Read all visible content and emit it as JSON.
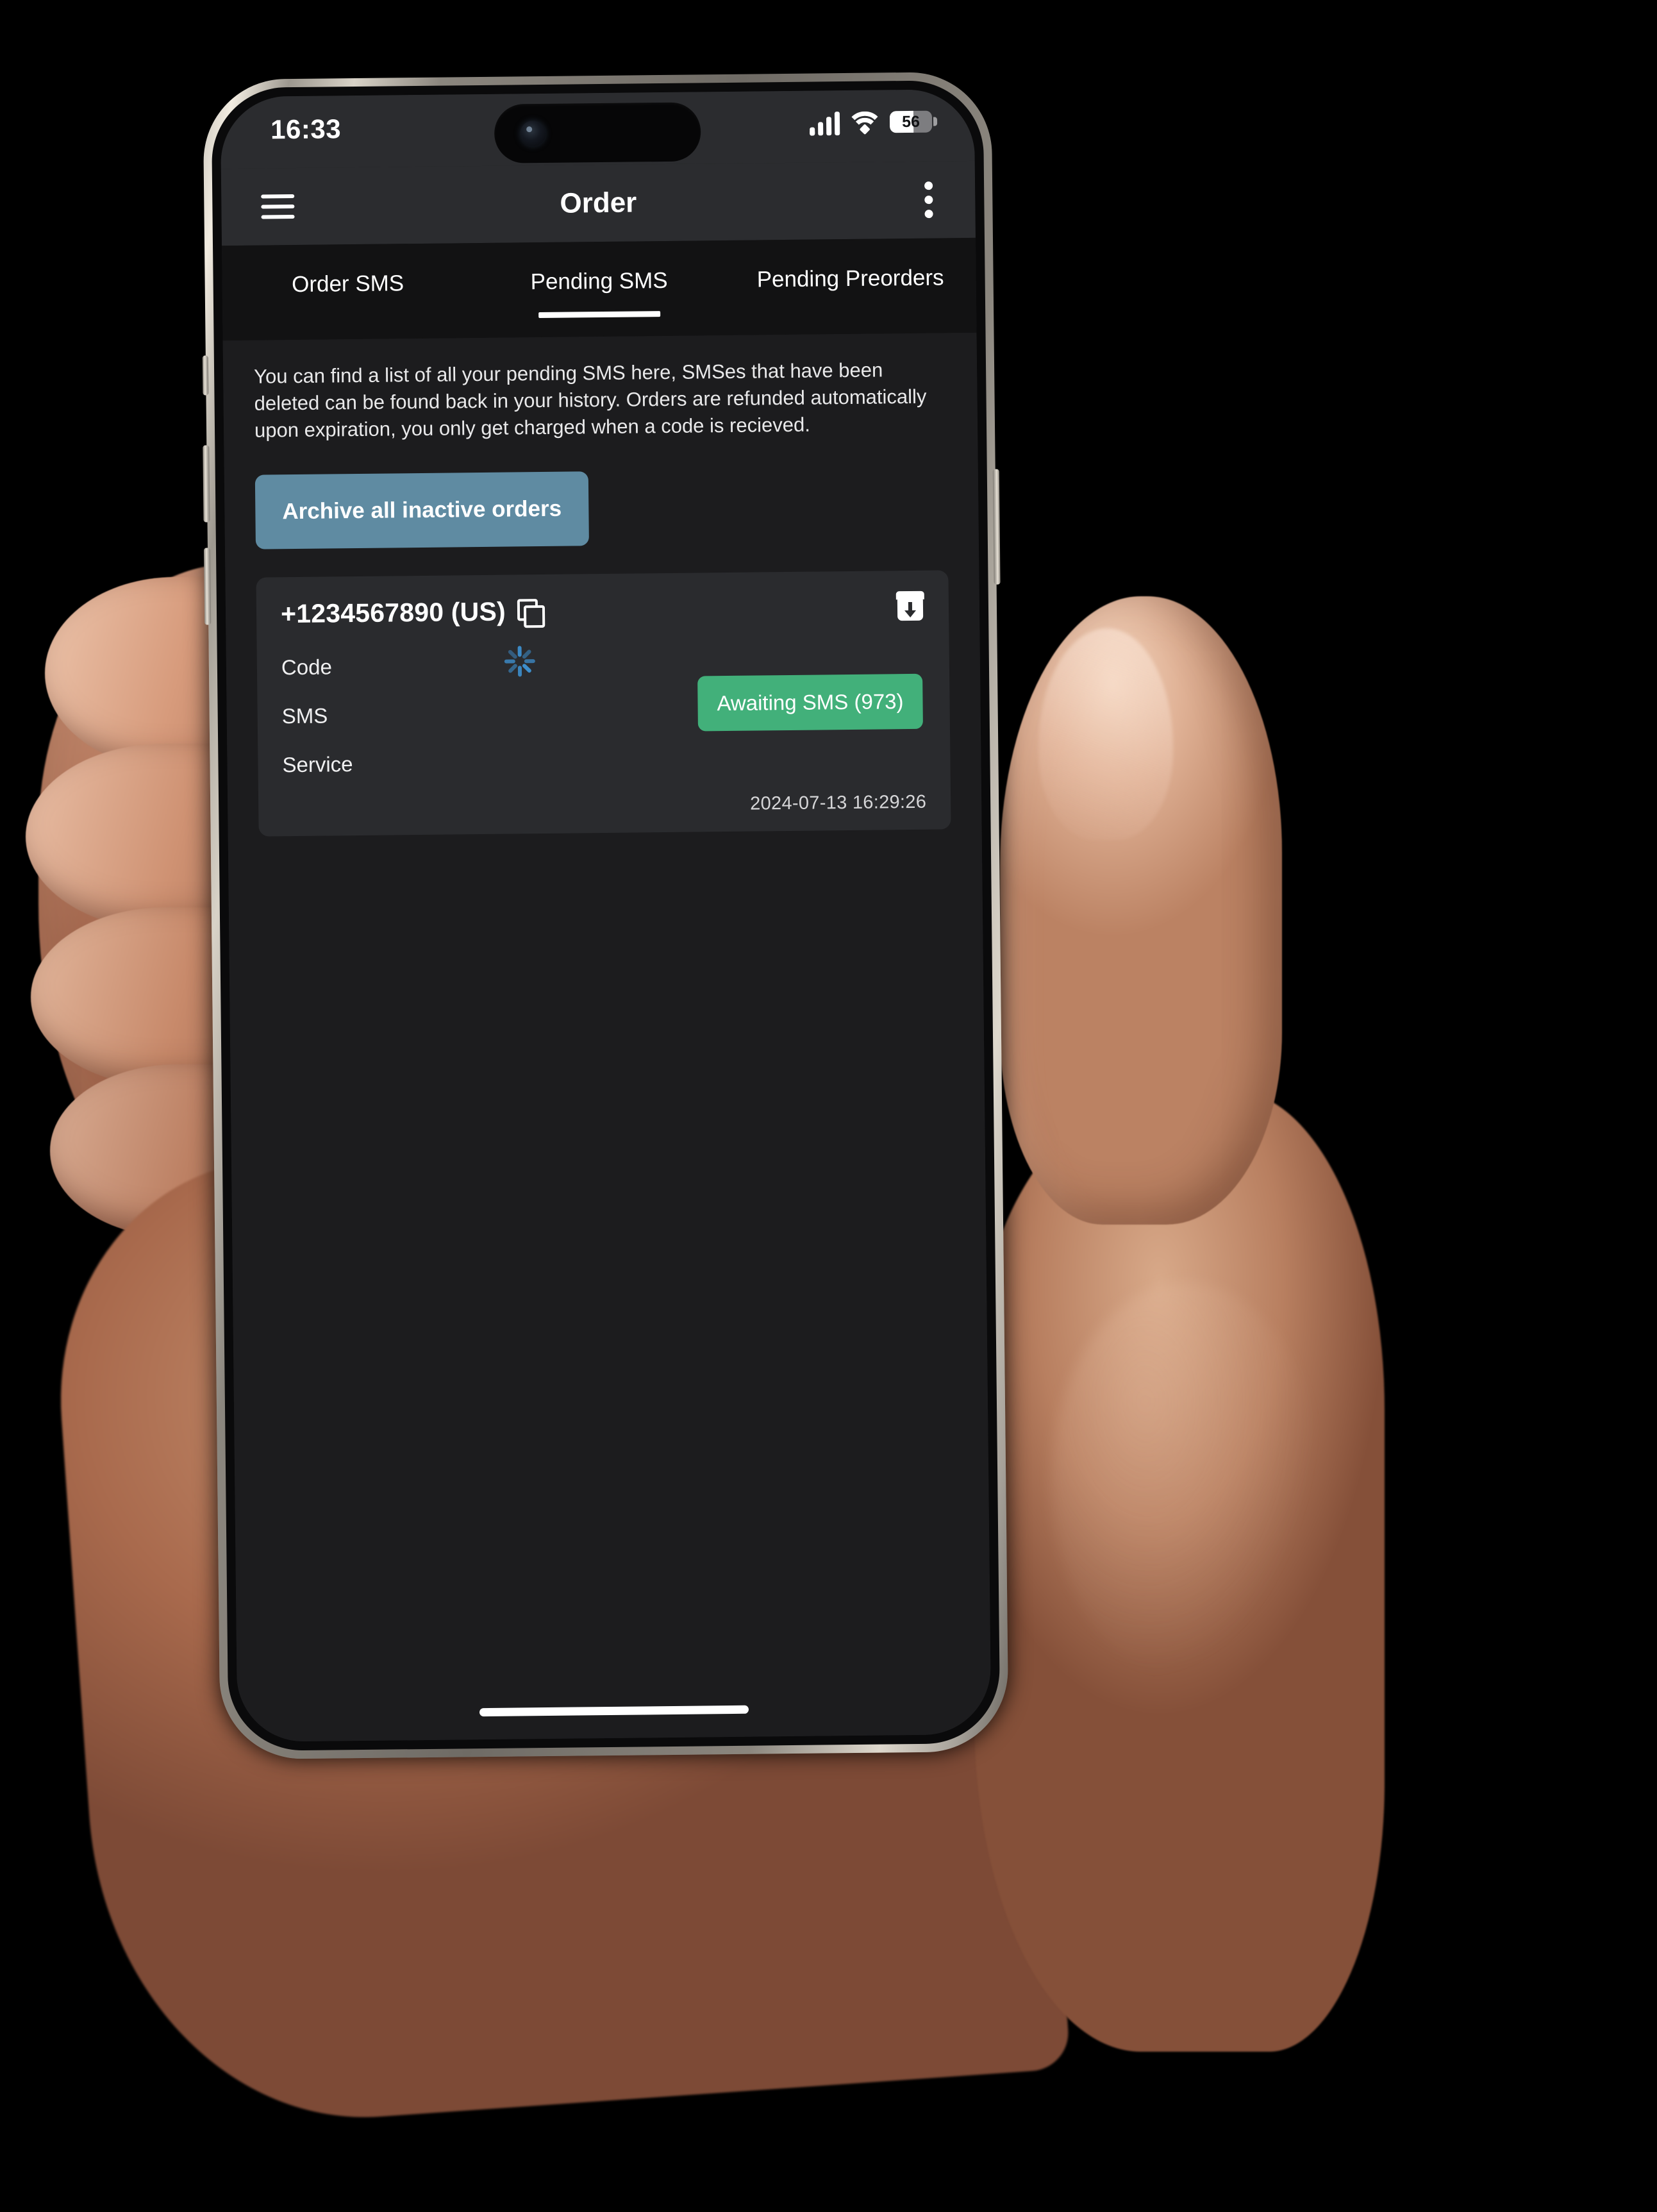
{
  "status_bar": {
    "time": "16:33",
    "battery_percent": "56",
    "signal_icon": "cellular-signal-icon",
    "wifi_icon": "wifi-icon",
    "battery_icon": "battery-icon"
  },
  "app_bar": {
    "menu_icon": "hamburger-menu-icon",
    "title": "Order",
    "overflow_icon": "kebab-menu-icon"
  },
  "tabs": [
    {
      "label": "Order SMS",
      "active": false
    },
    {
      "label": "Pending SMS",
      "active": true
    },
    {
      "label": "Pending Preorders",
      "active": false
    }
  ],
  "content": {
    "description": "You can find a list of all your pending SMS here, SMSes that have been deleted can be found back in your history. Orders are refunded automatically upon expiration, you only get charged when a code is recieved.",
    "archive_all_button": "Archive all inactive orders"
  },
  "order_card": {
    "phone_number": "+1234567890 (US)",
    "copy_icon": "copy-icon",
    "archive_icon": "archive-box-icon",
    "rows": [
      {
        "label": "Code"
      },
      {
        "label": "SMS"
      },
      {
        "label": "Service"
      }
    ],
    "spinner_icon": "loading-spinner-icon",
    "status_badge": "Awaiting SMS (973)",
    "timestamp": "2024-07-13 16:29:26"
  },
  "colors": {
    "page_background": "#1c1c1e",
    "appbar_background": "#2b2c2f",
    "tabbar_background": "#121213",
    "card_background": "#2a2b2e",
    "archive_button": "#5f8ba2",
    "status_badge_green": "#42b07a",
    "spinner_blue": "#3d8ecc",
    "accent_text": "#ffffff"
  }
}
